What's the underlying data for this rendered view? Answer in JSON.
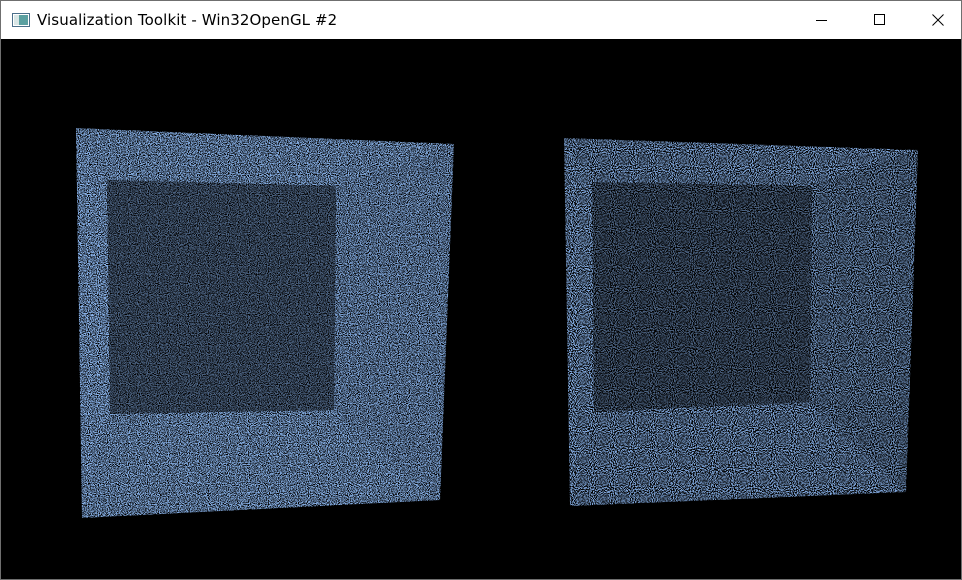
{
  "window": {
    "title": "Visualization Toolkit - Win32OpenGL #2",
    "app_icon": "vtk-window-icon",
    "controls": [
      "minimize-icon",
      "maximize-icon",
      "close-icon"
    ]
  },
  "render_view": {
    "background": "#000000",
    "point_color": "#8ab4ec",
    "objects": [
      {
        "name": "point-cloud-box-left",
        "type": "open-box point cloud"
      },
      {
        "name": "point-cloud-box-right",
        "type": "open-box point cloud"
      }
    ]
  }
}
